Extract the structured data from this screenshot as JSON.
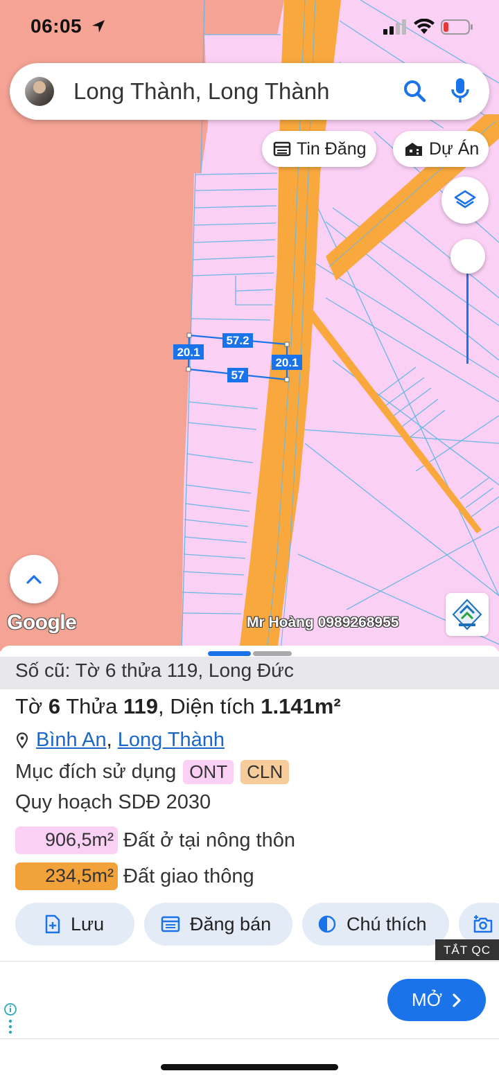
{
  "status_bar": {
    "time": "06:05"
  },
  "search": {
    "text": "Long Thành, Long Thành"
  },
  "chips": {
    "tin_dang": "Tin Đăng",
    "du_an": "Dự Án"
  },
  "map": {
    "dimensions": {
      "top": "57.2",
      "bottom": "57",
      "left": "20.1",
      "right": "20.1"
    },
    "attribution": "Google",
    "watermark": "Mr Hoàng 0989268955",
    "colors": {
      "zone_salmon": "#f4a394",
      "zone_pink": "#fbd0f5",
      "road": "#f8a83c",
      "parcel_line": "#6bb6e3",
      "selection": "#1a73e8"
    }
  },
  "sheet": {
    "old_info": "Số cũ: Tờ 6 thửa 119, Long Đức",
    "title": {
      "to_label": "Tờ",
      "to_value": "6",
      "thua_label": "Thửa",
      "thua_value": "119",
      "area_label": "Diện tích",
      "area_value": "1.141m²"
    },
    "address": {
      "ward": "Bình An",
      "sep": ",",
      "district": "Long Thành"
    },
    "purpose": {
      "label": "Mục đích sử dụng",
      "tags": [
        "ONT",
        "CLN"
      ]
    },
    "plan": "Quy hoạch SDĐ 2030",
    "land_use": [
      {
        "area": "906,5m²",
        "label": "Đất ở tại nông thôn",
        "color": "#fbd0f5"
      },
      {
        "area": "234,5m²",
        "label": "Đất giao thông",
        "color": "#f2a23a"
      }
    ],
    "actions": {
      "save": "Lưu",
      "post": "Đăng bán",
      "legend": "Chú thích"
    }
  },
  "ad": {
    "hide_label": "TẮT QC",
    "open_label": "MỞ"
  }
}
